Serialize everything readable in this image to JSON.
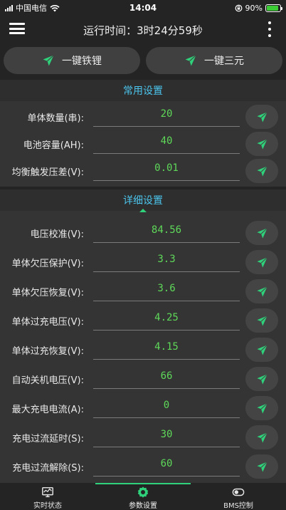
{
  "status_bar": {
    "carrier": "中国电信",
    "time": "14:04",
    "battery": "90%",
    "battery_level": 0.9
  },
  "header": {
    "runtime": "运行时间：3时24分59秒"
  },
  "quick_buttons": [
    {
      "label": "一键铁锂",
      "icon": "send-icon"
    },
    {
      "label": "一键三元",
      "icon": "send-icon"
    }
  ],
  "common_settings": {
    "title": "常用设置",
    "rows": [
      {
        "label": "单体数量(串):",
        "value": "20"
      },
      {
        "label": "电池容量(AH):",
        "value": "40"
      },
      {
        "label": "均衡触发压差(V):",
        "value": "0.01"
      }
    ]
  },
  "detail_settings": {
    "title": "详细设置",
    "rows": [
      {
        "label": "电压校准(V):",
        "value": "84.56"
      },
      {
        "label": "单体欠压保护(V):",
        "value": "3.3"
      },
      {
        "label": "单体欠压恢复(V):",
        "value": "3.6"
      },
      {
        "label": "单体过充电压(V):",
        "value": "4.25"
      },
      {
        "label": "单体过充恢复(V):",
        "value": "4.15"
      },
      {
        "label": "自动关机电压(V):",
        "value": "66"
      },
      {
        "label": "最大充电电流(A):",
        "value": "0"
      },
      {
        "label": "充电过流延时(S):",
        "value": "30"
      },
      {
        "label": "充电过流解除(S):",
        "value": "60"
      }
    ]
  },
  "bottom_nav": [
    {
      "label": "实时状态",
      "icon": "monitor-icon"
    },
    {
      "label": "参数设置",
      "icon": "gear-icon",
      "active": true
    },
    {
      "label": "BMS控制",
      "icon": "toggle-icon"
    }
  ],
  "colors": {
    "accent_green": "#2fd17a",
    "value_green": "#5fd85a",
    "title_blue": "#4cc4ec",
    "background": "#232423"
  }
}
